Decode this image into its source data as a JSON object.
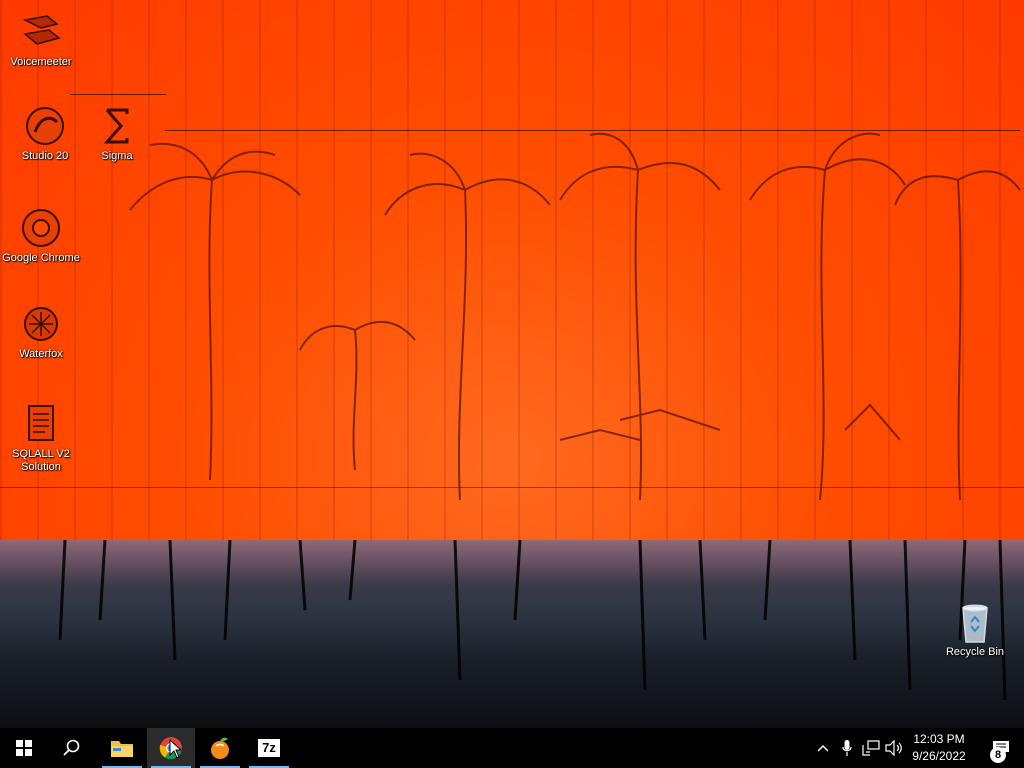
{
  "desktop": {
    "icons": [
      {
        "label": "Voicemeeter"
      },
      {
        "label": "Studio 20"
      },
      {
        "label": "Sigma"
      },
      {
        "label": "Google Chrome"
      },
      {
        "label": "Waterfox"
      },
      {
        "label": "SQLALL V2 Solution"
      },
      {
        "label": "Recycle Bin"
      }
    ]
  },
  "taskbar": {
    "pinned": [
      {
        "name": "windows-start",
        "icon": "windows-logo-icon"
      },
      {
        "name": "search",
        "icon": "search-icon"
      },
      {
        "name": "file-explorer",
        "icon": "folder-icon"
      },
      {
        "name": "chrome",
        "icon": "chrome-icon"
      },
      {
        "name": "fl-studio",
        "icon": "fruit-icon"
      },
      {
        "name": "7zip",
        "icon": "7z-icon",
        "text": "7z"
      }
    ],
    "tray": {
      "icons": [
        "chevron-up-icon",
        "microphone-icon",
        "network-icon",
        "volume-icon"
      ],
      "time": "12:03 PM",
      "date": "9/26/2022",
      "notification_count": "8"
    }
  },
  "colors": {
    "wallpaper_primary": "#ff4a00",
    "taskbar": "#000000",
    "active_underline": "#76b9ed"
  }
}
